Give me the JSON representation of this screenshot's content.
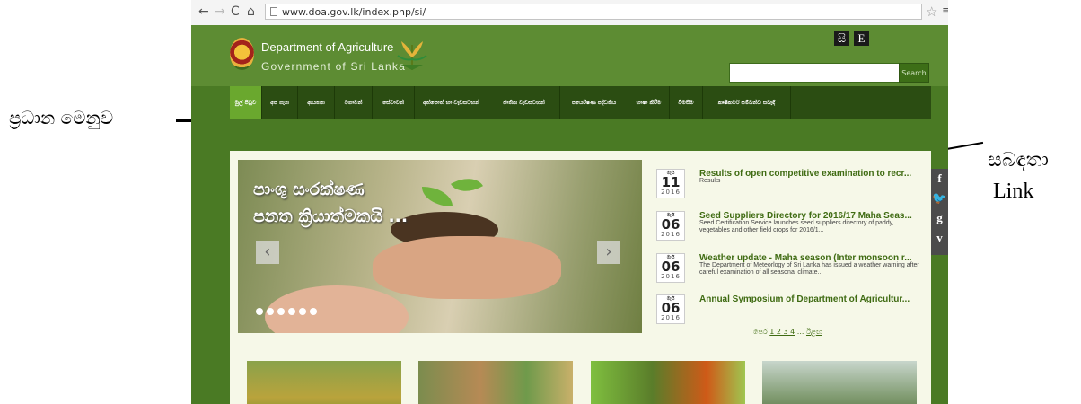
{
  "annotations": {
    "main_menu_label": "ප්‍රධාන මෙනුව",
    "related_link_label_1": "සබඳතා",
    "related_link_label_2": "Link"
  },
  "browser": {
    "url": "www.doa.gov.lk/index.php/si/"
  },
  "header": {
    "department": "Department of Agriculture",
    "government": "Government of Sri Lanka",
    "lang_si": "සි",
    "lang_en": "E",
    "search_placeholder": "",
    "search_button": "Search"
  },
  "nav": {
    "items": [
      "මුල් පිටුව",
      "අප ගැන",
      "ආයතන",
      "වගාවන්",
      "සේවාවන්",
      "අත්පොත් හා වැඩසටහන්",
      "ජාතික වැඩසටහන්",
      "පර්යේෂණ පද්ධතිය",
      "භාෂා කිරීම",
      "විමසීම",
      "කෘෂිකර්ම සම්බන්ධ සබැඳි"
    ]
  },
  "slider": {
    "line1": "පාංශු සංරක්ෂණ",
    "line2": "පනත ක්‍රියාත්මකයි ..."
  },
  "news": [
    {
      "month": "මැයි",
      "day": "11",
      "year": "2016",
      "title": "Results of open competitive examination to recr...",
      "desc": "Results"
    },
    {
      "month": "මැයි",
      "day": "06",
      "year": "2016",
      "title": "Seed Suppliers Directory for 2016/17 Maha Seas...",
      "desc": "Seed Certification Service launches seed suppliers directory of paddy,  vegetables and other field crops for 2016/1..."
    },
    {
      "month": "මැයි",
      "day": "06",
      "year": "2016",
      "title": "Weather update - Maha season (Inter monsoon r...",
      "desc": "The Department of Meteorlogy of Sri Lanka has issued a weather warning after careful examination of all seasonal climate..."
    },
    {
      "month": "මැයි",
      "day": "06",
      "year": "2016",
      "title": "Annual Symposium of Department of Agricultur...",
      "desc": ""
    }
  ],
  "pager": {
    "prev": "පෙර",
    "pages": "1 2 3 4",
    "ellipsis": "...",
    "next": "ඊළඟ"
  },
  "social": {
    "facebook": "f",
    "twitter": "t",
    "google": "g",
    "vimeo": "v"
  },
  "colors": {
    "header": "#5d8c33",
    "nav": "#2b4d12",
    "active": "#6aa82e",
    "link": "#3f6b12"
  }
}
